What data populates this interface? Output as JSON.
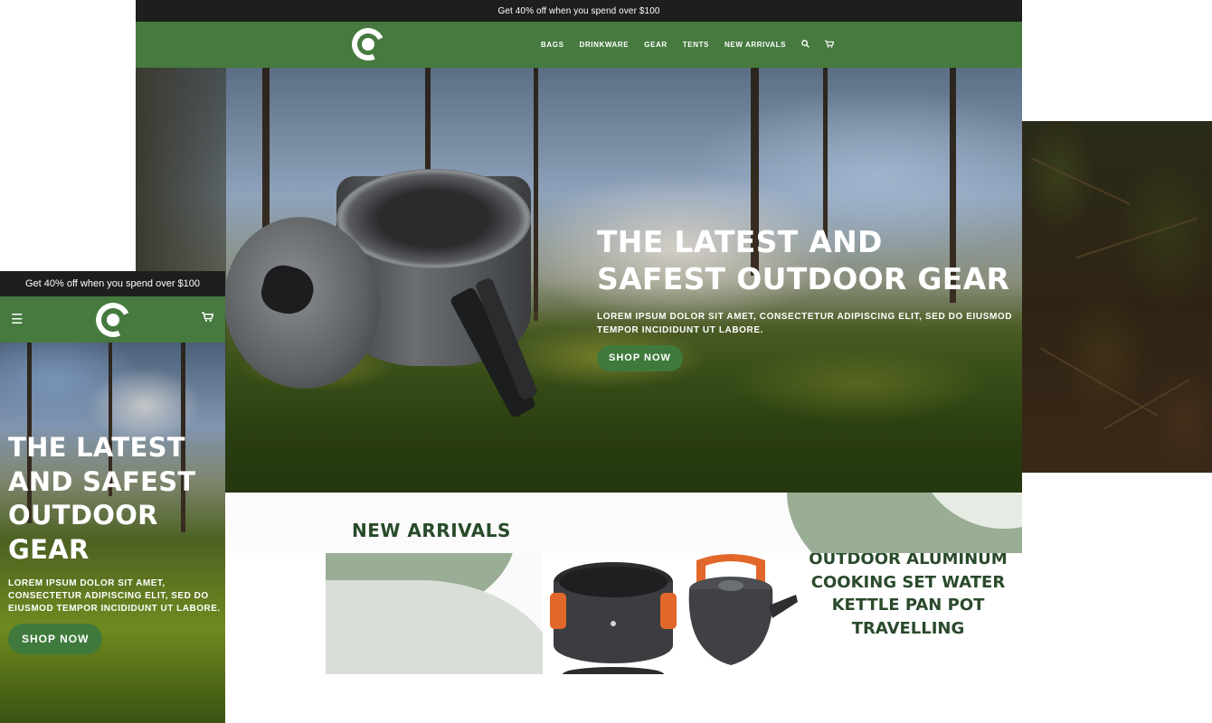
{
  "announcement": "Get 40% off when you spend over $100",
  "logo": {
    "icon": "brand-logo-icon"
  },
  "nav": {
    "links": [
      "BAGS",
      "DRINKWARE",
      "GEAR",
      "TENTS",
      "NEW ARRIVALS"
    ],
    "search_icon": "🔍",
    "cart_icon": "🛒"
  },
  "hero": {
    "title": "THE LATEST AND SAFEST OUTDOOR GEAR",
    "subtitle": "LOREM IPSUM DOLOR SIT AMET, CONSECTETUR ADIPISCING ELIT, SED DO EIUSMOD TEMPOR INCIDIDUNT UT LABORE.",
    "cta": "SHOP NOW"
  },
  "arrivals": {
    "title": "NEW ARRIVALS",
    "product_name": "OUTDOOR ALUMINUM COOKING SET WATER KETTLE PAN POT TRAVELLING"
  },
  "mobile": {
    "announcement": "Get 40% off when you spend over $100",
    "menu_icon": "☰",
    "cart_icon": "🛒",
    "title": "THE LATEST AND SAFEST OUTDOOR GEAR",
    "subtitle": "LOREM IPSUM DOLOR SIT AMET, CONSECTETUR ADIPISCING ELIT, SED DO EIUSMOD TEMPOR INCIDIDUNT UT LABORE.",
    "cta": "SHOP NOW"
  },
  "colors": {
    "brand_green": "#467a3f",
    "button_green": "#3f7a3c",
    "announcement_bg": "#1e1f1d",
    "heading_green": "#284b2a",
    "blob_green": "#9aae96"
  }
}
